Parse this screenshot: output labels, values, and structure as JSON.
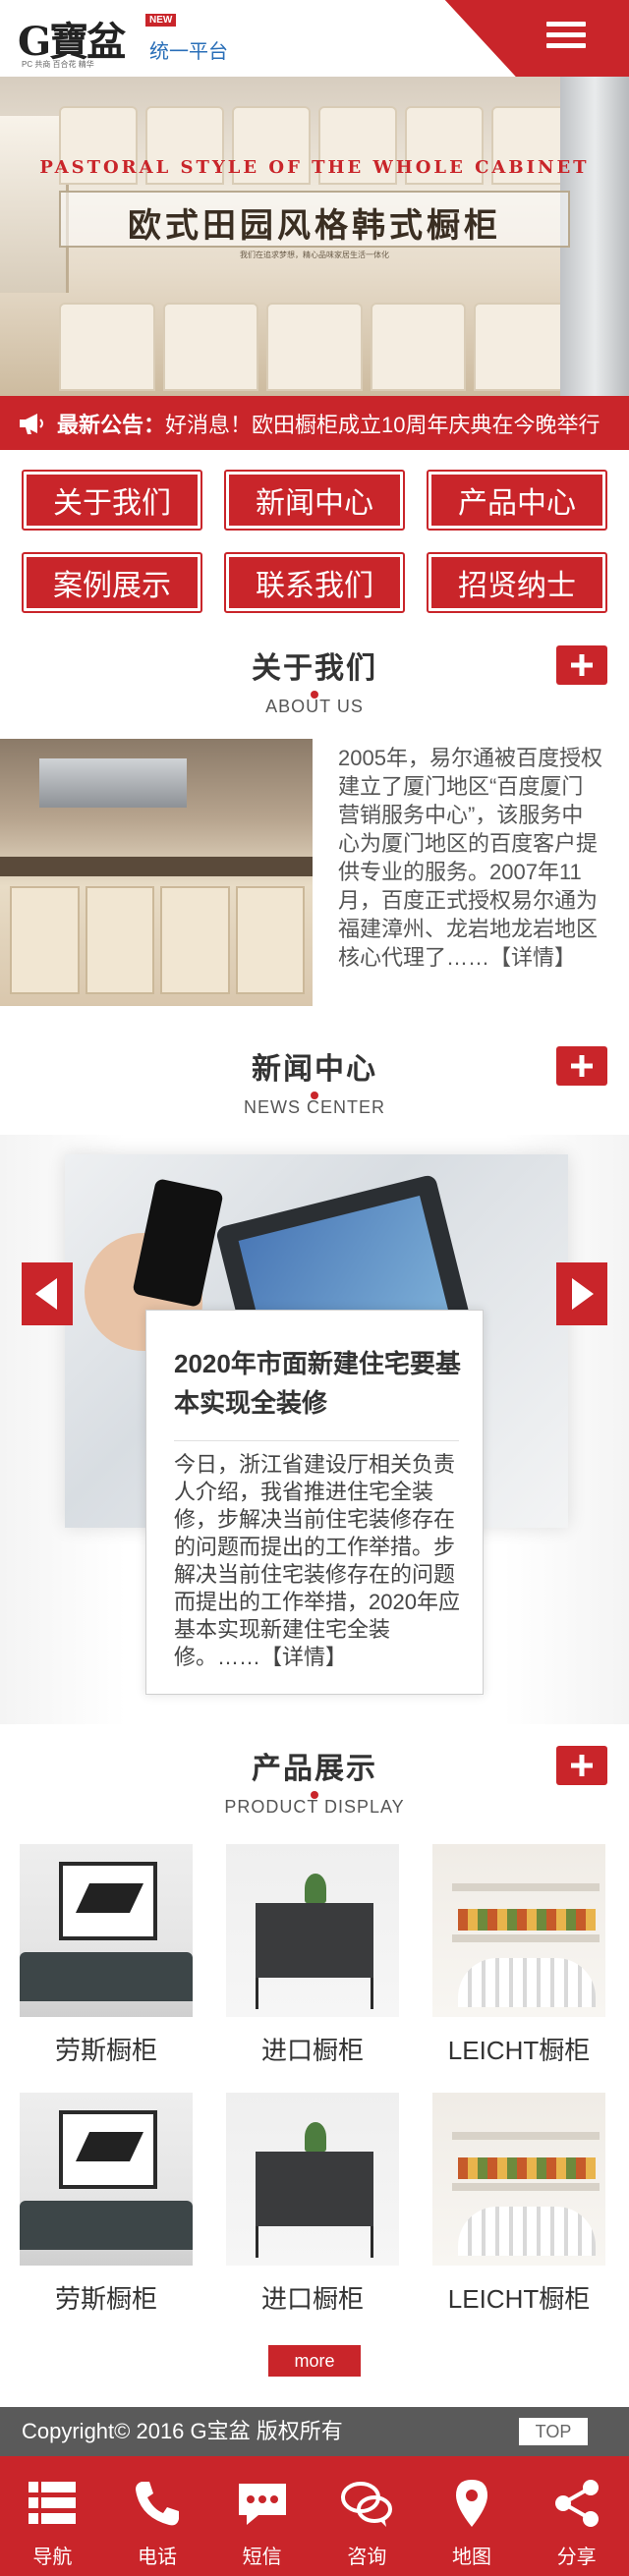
{
  "header": {
    "logo_text": "G寶盆",
    "logo_sub": "PC 共商 百合花 精华",
    "new_badge": "NEW",
    "logo_title": "统一平台",
    "menu_icon": "hamburger-menu-icon"
  },
  "banner": {
    "en_title": "PASTORAL STYLE OF THE WHOLE CABINET",
    "cn_title": "欧式田园风格韩式橱柜",
    "small_text": "我们在追求梦想，精心品味家居生活一体化"
  },
  "notice": {
    "label": "最新公告：",
    "text": "好消息！欧田橱柜成立10周年庆典在今晚举行",
    "icon": "megaphone-icon"
  },
  "nav": [
    {
      "label": "关于我们"
    },
    {
      "label": "新闻中心"
    },
    {
      "label": "产品中心"
    },
    {
      "label": "案例展示"
    },
    {
      "label": "联系我们"
    },
    {
      "label": "招贤纳士"
    }
  ],
  "about": {
    "title": "关于我们",
    "subtitle": "ABOUT US",
    "text": "2005年，易尔通被百度授权建立了厦门地区“百度厦门营销服务中心”，该服务中心为厦门地区的百度客户提供专业的服务。2007年11月，百度正式授权易尔通为福建漳州、龙岩地龙岩地区核心代理了……【详情】"
  },
  "news": {
    "title": "新闻中心",
    "subtitle": "NEWS CENTER",
    "card_title": "2020年市面新建住宅要基本实现全装修",
    "card_body": "今日，浙江省建设厅相关负责人介绍，我省推进住宅全装修，步解决当前住宅装修存在的问题而提出的工作举措。步解决当前住宅装修存在的问题而提出的工作举措，2020年应基本实现新建住宅全装修。……【详情】"
  },
  "products": {
    "title": "产品展示",
    "subtitle": "PRODUCT DISPLAY",
    "items": [
      {
        "name": "劳斯橱柜"
      },
      {
        "name": "进口橱柜"
      },
      {
        "name": "LEICHT橱柜"
      },
      {
        "name": "劳斯橱柜"
      },
      {
        "name": "进口橱柜"
      },
      {
        "name": "LEICHT橱柜"
      }
    ],
    "more_label": "more"
  },
  "footer": {
    "copyright": "Copyright© 2016  G宝盆 版权所有",
    "top_label": "TOP"
  },
  "bottom_nav": [
    {
      "label": "导航",
      "icon": "list-icon"
    },
    {
      "label": "电话",
      "icon": "phone-icon"
    },
    {
      "label": "短信",
      "icon": "sms-icon"
    },
    {
      "label": "咨询",
      "icon": "chat-icon"
    },
    {
      "label": "地图",
      "icon": "map-pin-icon"
    },
    {
      "label": "分享",
      "icon": "share-icon"
    }
  ],
  "colors": {
    "brand_red": "#c9252a",
    "footer_gray": "#5a5a5a"
  }
}
